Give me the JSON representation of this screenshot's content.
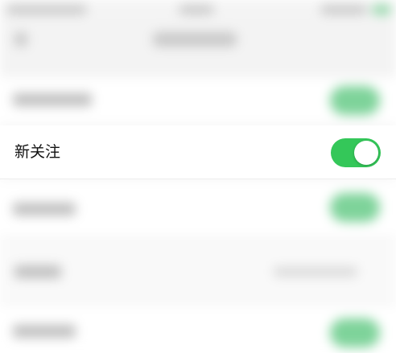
{
  "setting_row": {
    "label": "新关注",
    "toggle_state": "on",
    "toggle_color": "#34c759"
  },
  "theme": {
    "background": "#f6f6f6",
    "row_background": "#ffffff",
    "toggle_on_color": "#34c759"
  }
}
